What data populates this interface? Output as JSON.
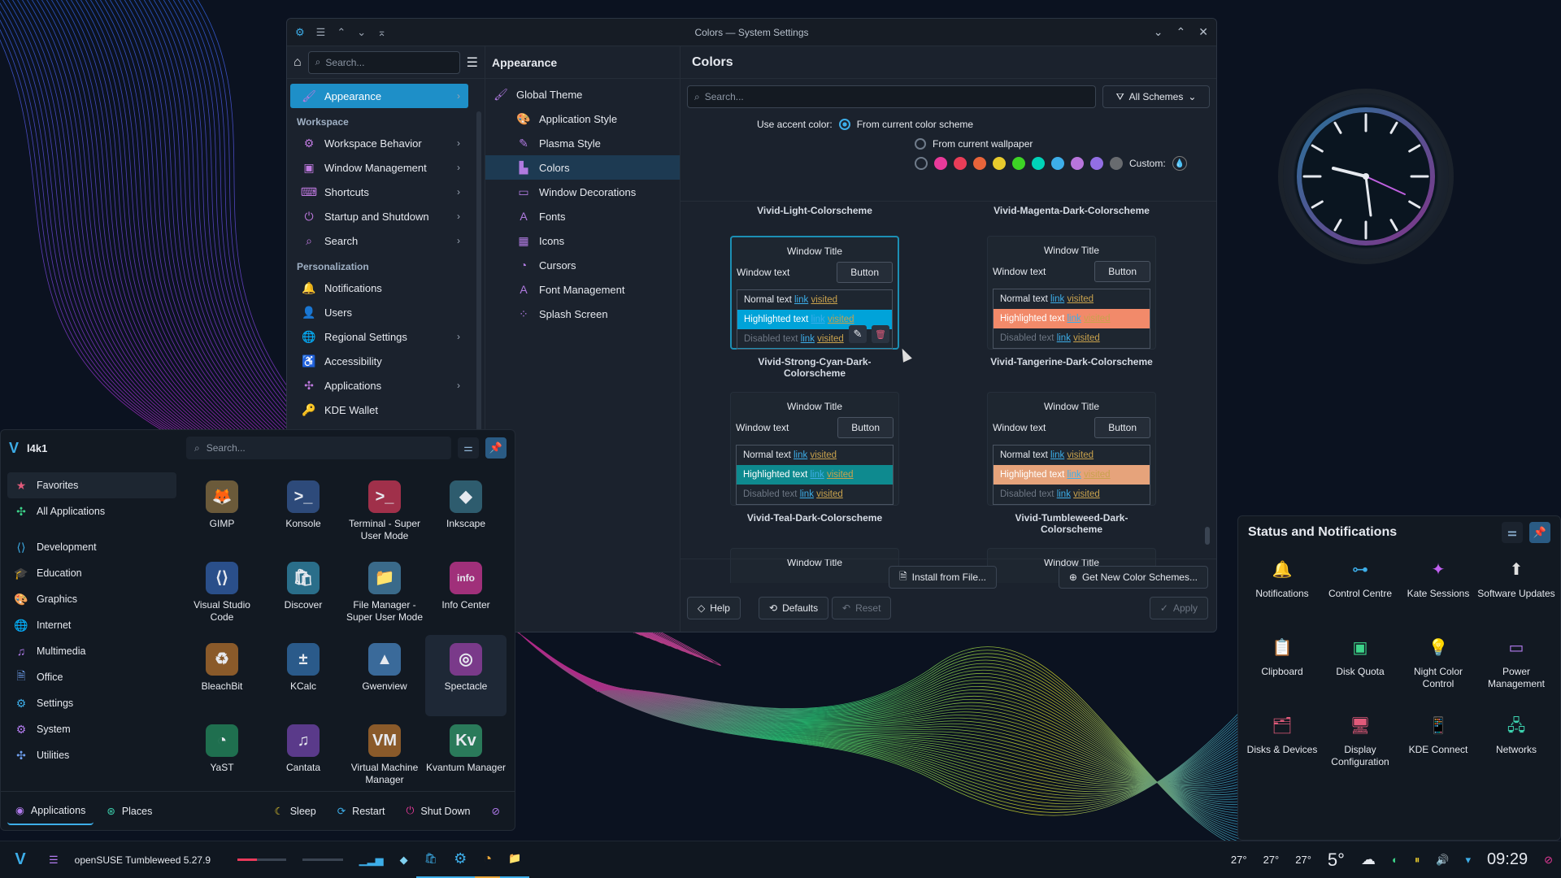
{
  "window": {
    "title": "Colors — System Settings",
    "close": "✕",
    "maximize": "⌃",
    "minimize": "⌄"
  },
  "sidebar": {
    "search_placeholder": "Search...",
    "items": [
      {
        "label": "Appearance",
        "chevron": true,
        "selected": true
      },
      {
        "section": "Workspace"
      },
      {
        "label": "Workspace Behavior",
        "chevron": true
      },
      {
        "label": "Window Management",
        "chevron": true
      },
      {
        "label": "Shortcuts",
        "chevron": true
      },
      {
        "label": "Startup and Shutdown",
        "chevron": true
      },
      {
        "label": "Search",
        "chevron": true
      },
      {
        "section": "Personalization"
      },
      {
        "label": "Notifications"
      },
      {
        "label": "Users"
      },
      {
        "label": "Regional Settings",
        "chevron": true
      },
      {
        "label": "Accessibility"
      },
      {
        "label": "Applications",
        "chevron": true
      },
      {
        "label": "KDE Wallet"
      }
    ]
  },
  "subpanel": {
    "title": "Appearance",
    "items": [
      "Global Theme",
      "Application Style",
      "Plasma Style",
      "Colors",
      "Window Decorations",
      "Fonts",
      "Icons",
      "Cursors",
      "Font Management",
      "Splash Screen"
    ],
    "selected": "Colors"
  },
  "colors": {
    "title": "Colors",
    "search_placeholder": "Search...",
    "filter": "All Schemes",
    "accent_label": "Use accent color:",
    "opt_scheme": "From current color scheme",
    "opt_wallpaper": "From current wallpaper",
    "custom_label": "Custom:",
    "swatches": [
      "#1b222d",
      "#e93a9a",
      "#e93d58",
      "#e9643a",
      "#e8cb2d",
      "#3dd425",
      "#00d3b8",
      "#3daee9",
      "#b875dc",
      "#926ee4",
      "#686b6f"
    ],
    "top_names": [
      "Vivid-Light-Colorscheme",
      "Vivid-Magenta-Dark-Colorscheme"
    ],
    "schemes": [
      {
        "name": "Vivid-Strong-Cyan-Dark-Colorscheme",
        "hl": "#00a3d9",
        "current": true
      },
      {
        "name": "Vivid-Tangerine-Dark-Colorscheme",
        "hl": "#f28a6a"
      },
      {
        "name": "Vivid-Teal-Dark-Colorscheme",
        "hl": "#0e8a8f"
      },
      {
        "name": "Vivid-Tumbleweed-Dark-Colorscheme",
        "hl": "#e6a37b"
      }
    ],
    "preview": {
      "window_title": "Window Title",
      "window_text": "Window text",
      "button": "Button",
      "normal": "Normal text",
      "highlighted": "Highlighted text",
      "disabled": "Disabled text",
      "link": "link",
      "visited": "visited"
    },
    "install": "Install from File...",
    "get_new": "Get New Color Schemes...",
    "help": "Help",
    "defaults": "Defaults",
    "reset": "Reset",
    "apply": "Apply"
  },
  "launcher": {
    "user": "l4k1",
    "search_placeholder": "Search...",
    "categories": [
      "Favorites",
      "All Applications",
      "Development",
      "Education",
      "Graphics",
      "Internet",
      "Multimedia",
      "Office",
      "Settings",
      "System",
      "Utilities"
    ],
    "apps": [
      {
        "name": "GIMP",
        "glyph": "🦊",
        "color": "#6b5a3a"
      },
      {
        "name": "Konsole",
        "glyph": ">_",
        "color": "#2d4a7a"
      },
      {
        "name": "Terminal - Super User Mode",
        "glyph": ">_",
        "color": "#a0304a"
      },
      {
        "name": "Inkscape",
        "glyph": "◆",
        "color": "#2e5c6e"
      },
      {
        "name": "Visual Studio Code",
        "glyph": "⟨⟩",
        "color": "#2a4f8a"
      },
      {
        "name": "Discover",
        "glyph": "🛍",
        "color": "#2a6e8a"
      },
      {
        "name": "File Manager - Super User Mode",
        "glyph": "📁",
        "color": "#3a6a8a"
      },
      {
        "name": "Info Center",
        "glyph": "info",
        "color": "#a0307a"
      },
      {
        "name": "BleachBit",
        "glyph": "♻",
        "color": "#8a5a2a"
      },
      {
        "name": "KCalc",
        "glyph": "±",
        "color": "#2a5a8a"
      },
      {
        "name": "Gwenview",
        "glyph": "▲",
        "color": "#3a6a9a"
      },
      {
        "name": "Spectacle",
        "glyph": "◎",
        "color": "#7a3a8a"
      },
      {
        "name": "YaST",
        "glyph": "◔",
        "color": "#1f6f4f"
      },
      {
        "name": "Cantata",
        "glyph": "♫",
        "color": "#5a3a8a"
      },
      {
        "name": "Virtual Machine Manager",
        "glyph": "VM",
        "color": "#8a5a2a"
      },
      {
        "name": "Kvantum Manager",
        "glyph": "Kv",
        "color": "#2a7a5a"
      }
    ],
    "tab_apps": "Applications",
    "tab_places": "Places",
    "sleep": "Sleep",
    "restart": "Restart",
    "shutdown": "Shut Down"
  },
  "status": {
    "title": "Status and Notifications",
    "items": [
      {
        "label": "Notifications",
        "glyph": "🔔",
        "color": "#b37cf0"
      },
      {
        "label": "Control Centre",
        "glyph": "⊶",
        "color": "#3daee9"
      },
      {
        "label": "Kate Sessions",
        "glyph": "✦",
        "color": "#c060f0"
      },
      {
        "label": "Software Updates",
        "glyph": "⬆",
        "color": "#e0e0e0"
      },
      {
        "label": "Clipboard",
        "glyph": "📋",
        "color": "#e0b040"
      },
      {
        "label": "Disk Quota",
        "glyph": "▣",
        "color": "#3dd48a"
      },
      {
        "label": "Night Color Control",
        "glyph": "💡",
        "color": "#3daee9"
      },
      {
        "label": "Power Management",
        "glyph": "▭",
        "color": "#b37cf0"
      },
      {
        "label": "Disks & Devices",
        "glyph": "🗂",
        "color": "#e05a7a"
      },
      {
        "label": "Display Configuration",
        "glyph": "🖥",
        "color": "#e05a7a"
      },
      {
        "label": "KDE Connect",
        "glyph": "📱",
        "color": "#6fa0f0"
      },
      {
        "label": "Networks",
        "glyph": "🖧",
        "color": "#3dd4b0"
      }
    ]
  },
  "taskbar": {
    "distro": "openSUSE Tumbleweed 5.27.9",
    "temps": [
      "27°",
      "27°",
      "27°"
    ],
    "weather": "5°",
    "time": "09:29"
  }
}
